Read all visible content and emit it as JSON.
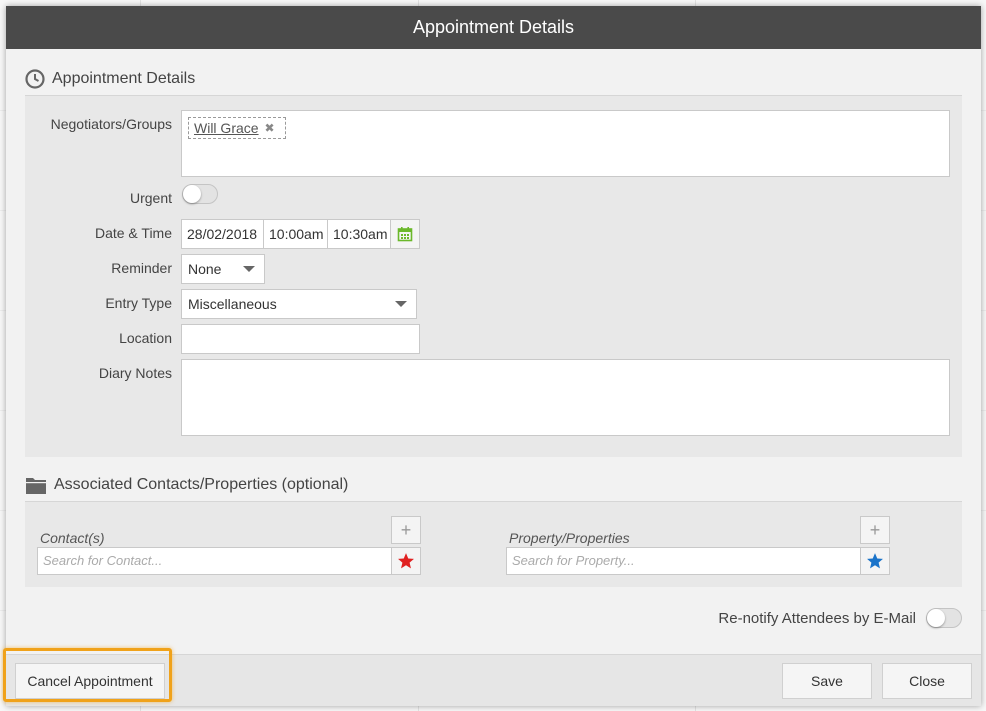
{
  "dialog": {
    "title": "Appointment Details"
  },
  "appointment_section": {
    "title": "Appointment Details",
    "negotiators": {
      "label": "Negotiators/Groups",
      "tags": [
        "Will Grace"
      ]
    },
    "urgent": {
      "label": "Urgent",
      "on": false
    },
    "datetime": {
      "label": "Date & Time",
      "date": "28/02/2018",
      "start": "10:00am",
      "end": "10:30am"
    },
    "reminder": {
      "label": "Reminder",
      "value": "None"
    },
    "entry_type": {
      "label": "Entry Type",
      "value": "Miscellaneous"
    },
    "location": {
      "label": "Location",
      "value": ""
    },
    "diary_notes": {
      "label": "Diary Notes",
      "value": ""
    }
  },
  "associated_section": {
    "title": "Associated Contacts/Properties (optional)",
    "contacts": {
      "label": "Contact(s)",
      "placeholder": "Search for Contact..."
    },
    "properties": {
      "label": "Property/Properties",
      "placeholder": "Search for Property..."
    }
  },
  "renotify": {
    "label": "Re-notify Attendees by E-Mail",
    "on": false
  },
  "footer": {
    "cancel_label": "Cancel Appointment",
    "save_label": "Save",
    "close_label": "Close"
  },
  "icons": {
    "clock": "clock-icon",
    "folder": "folder-icon",
    "calendar": "calendar-icon",
    "remove": "close-icon",
    "add": "plus-icon",
    "star": "star-icon"
  },
  "colors": {
    "header": "#4a4a4a",
    "contact_star": "#e02020",
    "property_star": "#1a73c9",
    "calendar": "#6bb82b",
    "highlight": "#f0a21a"
  }
}
